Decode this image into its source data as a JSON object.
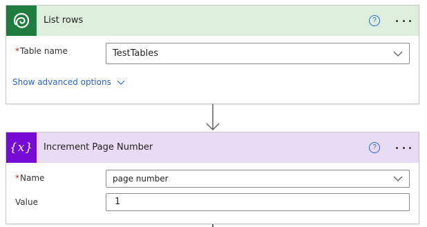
{
  "colors": {
    "list_rows_header_bg": "#deeedd",
    "list_rows_icon_bg": "#1d7c3e",
    "variable_header_bg": "#e8dcf4",
    "variable_icon_bg": "#770bd6",
    "link_blue": "#2b62d8",
    "required_red": "#a4262c"
  },
  "cards": [
    {
      "title": "List rows",
      "icon": "dataverse-icon",
      "help_glyph": "?",
      "fields": [
        {
          "label": "Table name",
          "required": "*",
          "value": "TestTables",
          "type": "dropdown"
        }
      ],
      "advanced_options_label": "Show advanced options"
    },
    {
      "title": "Increment Page Number",
      "icon": "variable-icon",
      "icon_glyph": "{x}",
      "help_glyph": "?",
      "fields": [
        {
          "label": "Name",
          "required": "*",
          "value": "page number",
          "type": "dropdown"
        },
        {
          "label": "Value",
          "required": "",
          "value": "1",
          "type": "text"
        }
      ]
    }
  ]
}
